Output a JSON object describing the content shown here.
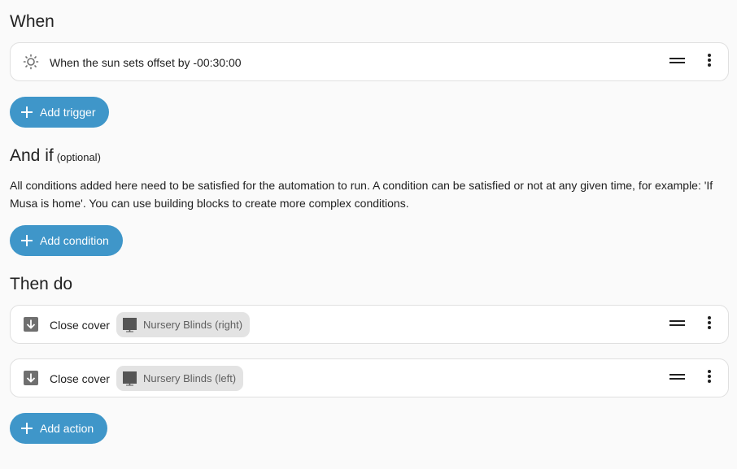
{
  "when": {
    "title": "When",
    "triggers": [
      {
        "icon": "sun-icon",
        "label": "When the sun sets offset by -00:30:00"
      }
    ],
    "add_label": "Add trigger"
  },
  "conditions": {
    "title": "And if",
    "optional_label": "(optional)",
    "description": "All conditions added here need to be satisfied for the automation to run. A condition can be satisfied or not at any given time, for example: 'If Musa is home'. You can use building blocks to create more complex conditions.",
    "add_label": "Add condition"
  },
  "actions": {
    "title": "Then do",
    "items": [
      {
        "icon": "arrow-down-box-icon",
        "label": "Close cover",
        "target": "Nursery Blinds (right)",
        "target_icon": "blinds-icon"
      },
      {
        "icon": "arrow-down-box-icon",
        "label": "Close cover",
        "target": "Nursery Blinds (left)",
        "target_icon": "blinds-icon"
      }
    ],
    "add_label": "Add action"
  },
  "colors": {
    "accent": "#3f96c9",
    "background": "#fafafa",
    "card": "#ffffff",
    "chip": "#e3e3e3"
  }
}
